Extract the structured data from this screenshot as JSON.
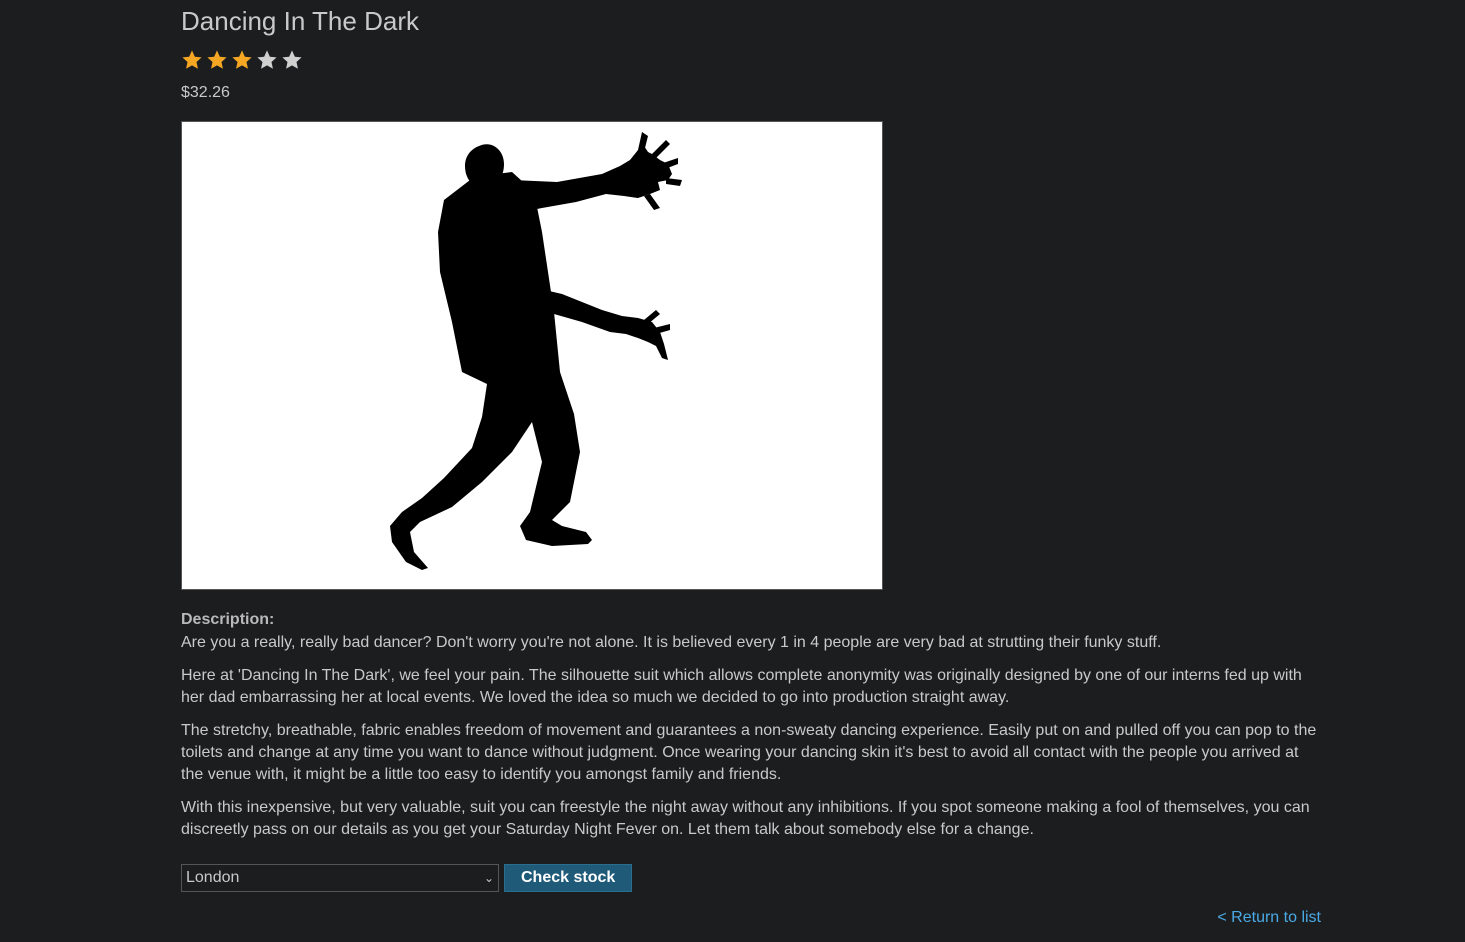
{
  "product": {
    "title": "Dancing In The Dark",
    "rating": {
      "value": 3,
      "max": 5
    },
    "price": "$32.26",
    "image_alt": "silhouette figure dancing"
  },
  "description": {
    "label": "Description:",
    "paragraphs": [
      "Are you a really, really bad dancer? Don't worry you're not alone. It is believed every 1 in 4 people are very bad at strutting their funky stuff.",
      "Here at 'Dancing In The Dark', we feel your pain. The silhouette suit which allows complete anonymity was originally designed by one of our interns fed up with her dad embarrassing her at local events. We loved the idea so much we decided to go into production straight away.",
      "The stretchy, breathable, fabric enables freedom of movement and guarantees a non-sweaty dancing experience. Easily put on and pulled off you can pop to the toilets and change at any time you want to dance without judgment. Once wearing your dancing skin it's best to avoid all contact with the people you arrived at the venue with, it might be a little too easy to identify you amongst family and friends.",
      "With this inexpensive, but very valuable, suit you can freestyle the night away without any inhibitions. If you spot someone making a fool of themselves, you can discreetly pass on our details as you get your Saturday Night Fever on. Let them talk about somebody else for a change."
    ]
  },
  "stock_check": {
    "selected_store": "London",
    "button_label": "Check stock"
  },
  "navigation": {
    "return_label": "< Return to list"
  },
  "colors": {
    "background": "#1c1d1f",
    "star_filled": "#f5a623",
    "star_empty": "#d0d0d0",
    "button": "#1f5a78",
    "link": "#4aaae6"
  },
  "icons": {
    "star": "star-icon",
    "dropdown": "chevron-down-icon"
  }
}
